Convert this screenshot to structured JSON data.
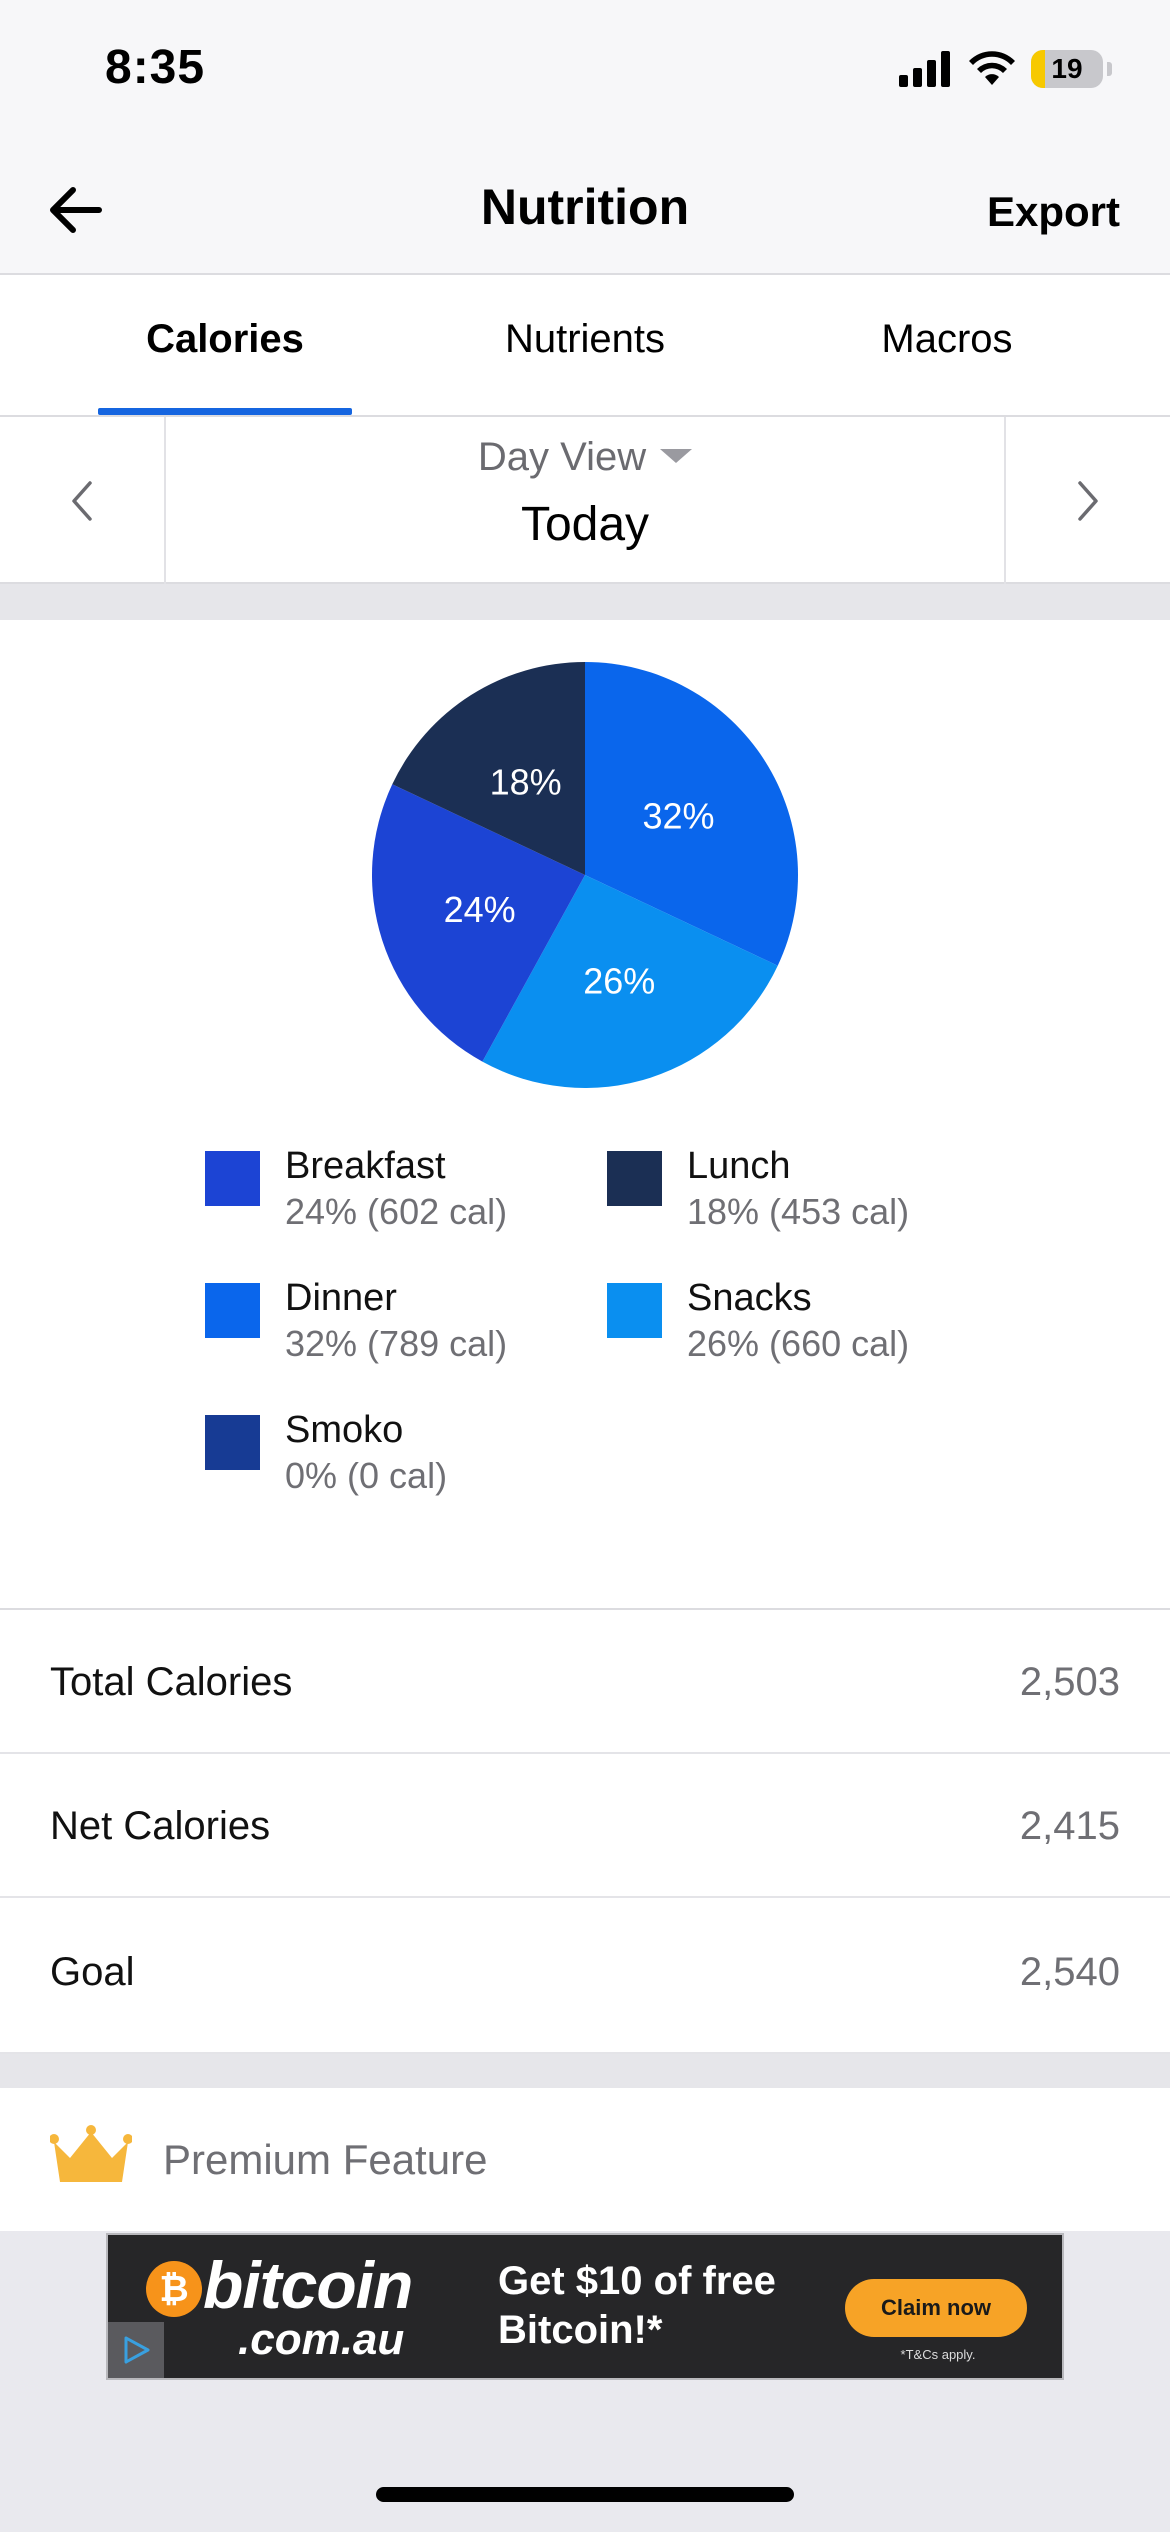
{
  "status_bar": {
    "time": "8:35",
    "battery_level": 19,
    "battery_text": "19"
  },
  "nav": {
    "title": "Nutrition",
    "export_label": "Export"
  },
  "tabs": [
    {
      "label": "Calories",
      "active": true
    },
    {
      "label": "Nutrients",
      "active": false
    },
    {
      "label": "Macros",
      "active": false
    }
  ],
  "day_selector": {
    "view_label": "Day View",
    "day_label": "Today"
  },
  "chart_data": {
    "type": "pie",
    "slices": [
      {
        "name": "Dinner",
        "percent": 32,
        "label": "32%",
        "color": "#0a66ec"
      },
      {
        "name": "Snacks",
        "percent": 26,
        "label": "26%",
        "color": "#0a8ff0"
      },
      {
        "name": "Breakfast",
        "percent": 24,
        "label": "24%",
        "color": "#1c44d4"
      },
      {
        "name": "Lunch",
        "percent": 18,
        "label": "18%",
        "color": "#1b2f54"
      }
    ]
  },
  "legend": [
    {
      "name": "Breakfast",
      "detail": "24% (602 cal)",
      "color": "#1c44d4"
    },
    {
      "name": "Lunch",
      "detail": "18% (453 cal)",
      "color": "#1b2f54"
    },
    {
      "name": "Dinner",
      "detail": "32% (789 cal)",
      "color": "#0a66ec"
    },
    {
      "name": "Snacks",
      "detail": "26% (660 cal)",
      "color": "#0a8ff0"
    },
    {
      "name": "Smoko",
      "detail": "0% (0 cal)",
      "color": "#173b94"
    }
  ],
  "stats": {
    "total": {
      "label": "Total Calories",
      "value": "2,503"
    },
    "net": {
      "label": "Net Calories",
      "value": "2,415"
    },
    "goal": {
      "label": "Goal",
      "value": "2,540"
    }
  },
  "premium": {
    "label": "Premium Feature",
    "icon": "crown-icon"
  },
  "ad": {
    "coin_symbol": "₿",
    "brand": "bitcoin",
    "domain": ".com.au",
    "headline": "Get $10 of free Bitcoin!*",
    "cta": "Claim now",
    "disclaimer": "*T&Cs apply."
  },
  "colors": {
    "accent": "#1565e0",
    "premium_gold": "#f6b73c"
  }
}
